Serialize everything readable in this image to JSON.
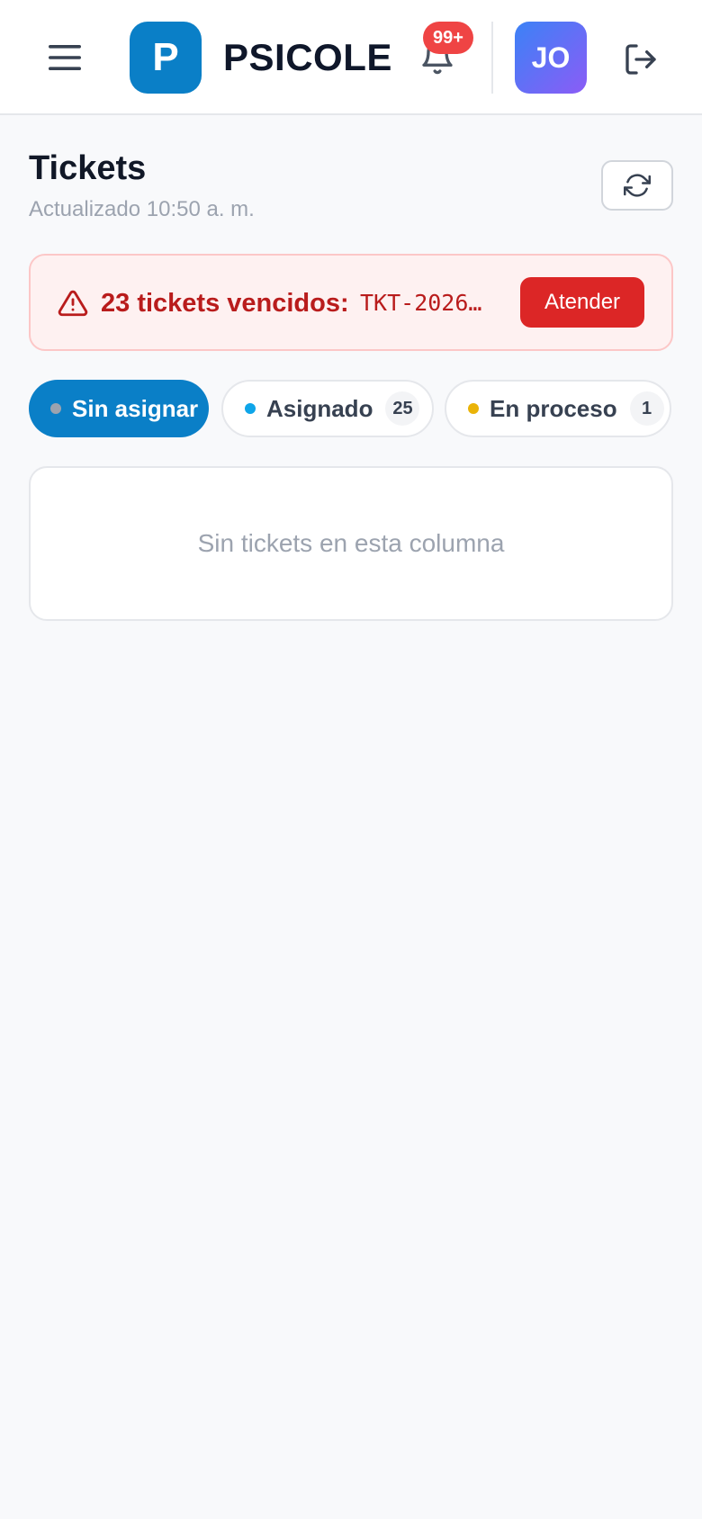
{
  "header": {
    "logo_letter": "P",
    "app_name": "PSICOLE",
    "notification_badge": "99+",
    "user_initials": "JO"
  },
  "page": {
    "title": "Tickets",
    "updated_text": "Actualizado 10:50 a. m."
  },
  "alert": {
    "title": "23 tickets vencidos:",
    "ticket_code": "TKT-2026-…",
    "action_label": "Atender"
  },
  "tabs": [
    {
      "label": "Sin asignar",
      "count": null,
      "dot_color": "#9ca3af",
      "active": true
    },
    {
      "label": "Asignado",
      "count": "25",
      "dot_color": "#0ea5e9",
      "active": false
    },
    {
      "label": "En proceso",
      "count": "1",
      "dot_color": "#eab308",
      "active": false
    }
  ],
  "column": {
    "empty_text": "Sin tickets en esta columna"
  },
  "colors": {
    "brand": "#0a7fc7",
    "alert_red": "#dc2626",
    "alert_bg": "#fef1f1",
    "badge_red": "#ef4444"
  }
}
